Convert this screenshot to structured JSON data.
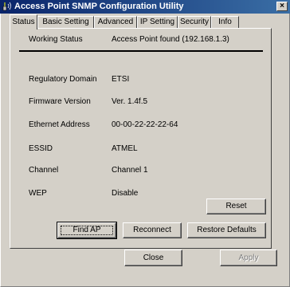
{
  "window": {
    "title": "Access Point SNMP Configuration Utility",
    "close_glyph": "×"
  },
  "tabs": [
    {
      "label": "Status",
      "active": true
    },
    {
      "label": "Basic Setting"
    },
    {
      "label": "Advanced"
    },
    {
      "label": "IP Setting"
    },
    {
      "label": "Security"
    },
    {
      "label": "Info"
    }
  ],
  "status": {
    "working_status_label": "Working Status",
    "working_status_value": "Access Point found (192.168.1.3)",
    "regulatory_domain_label": "Regulatory Domain",
    "regulatory_domain_value": "ETSI",
    "firmware_version_label": "Firmware Version",
    "firmware_version_value": "Ver. 1.4f.5",
    "ethernet_address_label": "Ethernet Address",
    "ethernet_address_value": "00-00-22-22-22-64",
    "essid_label": "ESSID",
    "essid_value": "ATMEL",
    "channel_label": "Channel",
    "channel_value": "Channel  1",
    "wep_label": "WEP",
    "wep_value": "Disable"
  },
  "buttons": {
    "reset": "Reset",
    "find_ap": "Find AP",
    "reconnect": "Reconnect",
    "restore_defaults": "Restore Defaults",
    "close": "Close",
    "apply": "Apply"
  },
  "icons": {
    "app_icon": "wireless-antenna-icon",
    "close": "close-icon"
  }
}
